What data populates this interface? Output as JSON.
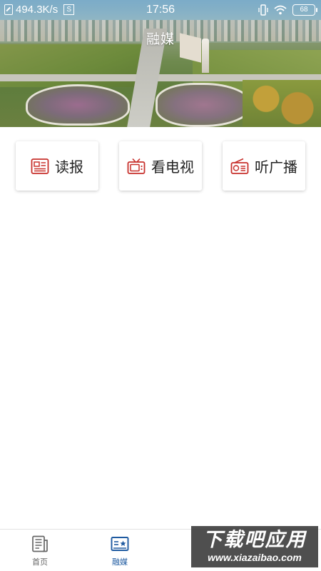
{
  "status_bar": {
    "network_speed": "494.3K/s",
    "s_badge": "S",
    "time": "17:56",
    "battery": "68"
  },
  "header": {
    "title": "融媒"
  },
  "shortcuts": [
    {
      "label": "读报",
      "icon": "newspaper-icon"
    },
    {
      "label": "看电视",
      "icon": "tv-icon"
    },
    {
      "label": "听广播",
      "icon": "radio-icon"
    }
  ],
  "tabbar": {
    "tabs": [
      {
        "label": "首页",
        "icon": "home-document-icon",
        "active": false
      },
      {
        "label": "融媒",
        "icon": "media-card-icon",
        "active": true
      }
    ]
  },
  "watermark": {
    "main": "下载吧应用",
    "url": "www.xiazaibao.com"
  },
  "colors": {
    "accent_red": "#c8302c",
    "active_tab_blue": "#1e5aa0",
    "inactive_tab_gray": "#666666"
  }
}
